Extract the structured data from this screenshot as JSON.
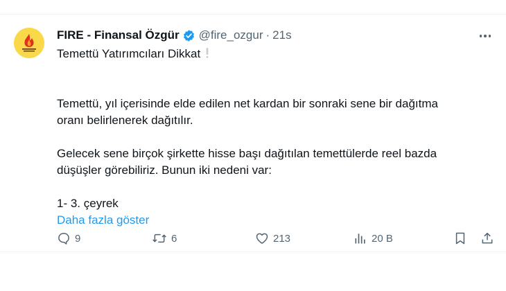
{
  "tweet": {
    "author_name": "FIRE - Finansal Özgür",
    "handle": "@fire_ozgur",
    "separator": "·",
    "time": "21s",
    "lines": [
      "Temettü Yatırımcıları Dikkat",
      "Temettü, yıl içerisinde elde edilen net kardan bir sonraki sene bir dağıtma",
      "oranı belirlenerek dağıtılır.",
      "Gelecek sene birçok şirkette hisse başı dağıtılan temettülerde reel bazda",
      "düşüşler görebiliriz. Bunun iki nedeni var:",
      "1- 3. çeyrek"
    ],
    "show_more": "Daha fazla göster",
    "stats": {
      "replies": "9",
      "reposts": "6",
      "likes": "213",
      "views": "20 B"
    }
  },
  "colors": {
    "accent": "#1d9bf0",
    "muted": "#536471",
    "text": "#0f1419",
    "avatar_bg": "#f9d84a"
  },
  "icons": [
    "fire-logo-icon",
    "verified-badge-icon",
    "more-dots-icon",
    "exclamation-icon",
    "reply-icon",
    "repost-icon",
    "like-icon",
    "views-icon",
    "bookmark-icon",
    "share-icon"
  ]
}
